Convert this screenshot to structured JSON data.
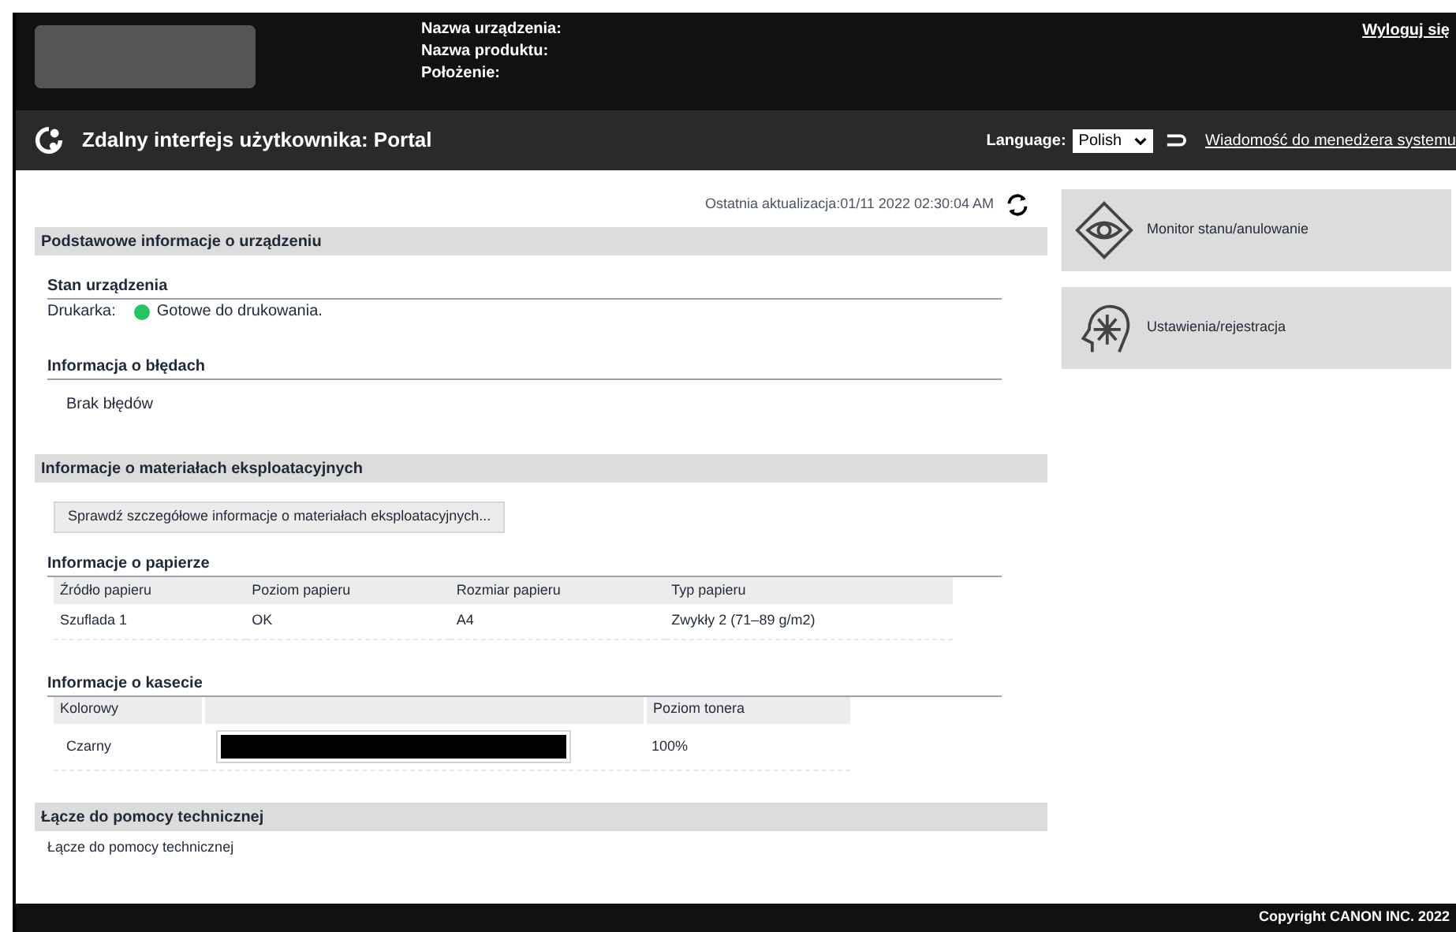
{
  "header": {
    "device_labels": [
      "Nazwa urządzenia:",
      "Nazwa produktu:",
      "Położenie:"
    ],
    "logout": "Wyloguj się"
  },
  "nav_bar": {
    "title": "Zdalny interfejs użytkownika: Portal",
    "language_label": "Language:",
    "language_value": "Polish",
    "message_link": "Wiadomość do menedżera systemu"
  },
  "last_update": "Ostatnia aktualizacja:01/11 2022 02:30:04 AM",
  "basic_info": {
    "heading": "Podstawowe informacje o urządzeniu",
    "status_heading": "Stan urządzenia",
    "printer_label": "Drukarka:",
    "printer_status": "Gotowe do drukowania.",
    "ready": true,
    "errors_heading": "Informacja o błędach",
    "errors_text": "Brak błędów"
  },
  "consumables": {
    "heading": "Informacje o materiałach eksploatacyjnych",
    "details_button": "Sprawdź szczegółowe informacje o materiałach eksploatacyjnych...",
    "paper": {
      "heading": "Informacje o papierze",
      "columns": [
        "Źródło papieru",
        "Poziom papieru",
        "Rozmiar papieru",
        "Typ papieru"
      ],
      "rows": [
        [
          "Szuflada 1",
          "OK",
          "A4",
          "Zwykły 2 (71–89 g/m2)"
        ]
      ]
    },
    "cartridge": {
      "heading": "Informacje o kasecie",
      "columns": [
        "Kolorowy",
        "Poziom tonera"
      ],
      "rows": [
        {
          "color_name": "Czarny",
          "level": 1.0,
          "reading": "100%"
        }
      ]
    }
  },
  "support": {
    "heading": "Łącze do pomocy technicznej",
    "link": "Łącze do pomocy technicznej"
  },
  "side_menu": [
    {
      "kind": "monitor",
      "label": "Monitor stanu/anulowanie"
    },
    {
      "kind": "settings",
      "label": "Ustawienia/rejestracja"
    }
  ],
  "footer": "Copyright CANON INC. 2022"
}
